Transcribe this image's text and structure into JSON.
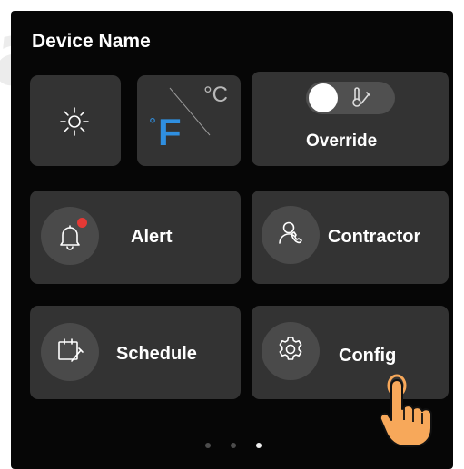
{
  "watermark": "anoved",
  "header": {
    "title": "Device Name"
  },
  "units": {
    "celsius": "°C",
    "fahrenheit_degree": "°",
    "fahrenheit_letter": "F"
  },
  "override": {
    "label": "Override",
    "toggle_state": "on"
  },
  "tiles": {
    "alert": {
      "label": "Alert",
      "has_notification": true
    },
    "contractor": {
      "label": "Contractor"
    },
    "schedule": {
      "label": "Schedule"
    },
    "config": {
      "label": "Config"
    }
  },
  "pager": {
    "pages": 3,
    "active_page": 3
  },
  "colors": {
    "accent_blue": "#2f8fe0",
    "notification_red": "#e53935",
    "tile_bg": "#333333",
    "icon_circle_bg": "#4a4a4a",
    "hand_fill": "#f7a85a"
  }
}
